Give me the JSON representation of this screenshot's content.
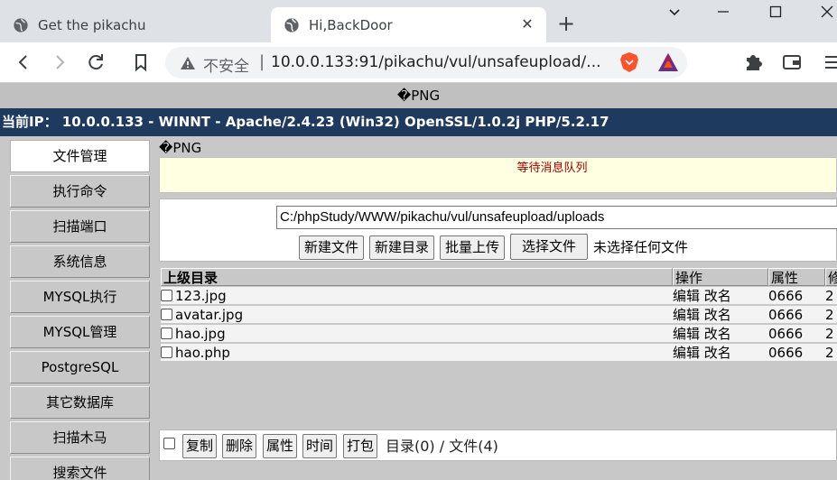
{
  "browser": {
    "tabs": [
      {
        "title": "Get the pikachu",
        "active": false
      },
      {
        "title": "Hi,BackDoor",
        "active": true
      }
    ],
    "new_tab": "+",
    "window_controls": {
      "minimize": "—",
      "maximize": "☐",
      "close": "✕",
      "dropdown": "⌄"
    },
    "omnibox": {
      "security_label": "不安全",
      "separator": "|",
      "url": "10.0.0.133:91/pikachu/vul/unsafeupload/..."
    },
    "icons": [
      "back-icon",
      "forward-icon",
      "reload-icon",
      "bookmark-icon",
      "warning-icon",
      "brave-shield-icon",
      "bat-rewards-icon",
      "extensions-icon",
      "wallet-icon",
      "menu-icon"
    ]
  },
  "page": {
    "top_text": "�PNG",
    "ip_bar": "当前IP： 10.0.0.133 - WINNT - Apache/2.4.23 (Win32) OpenSSL/1.0.2j PHP/5.2.17",
    "sidebar": [
      {
        "label": "文件管理",
        "active": true
      },
      {
        "label": "执行命令",
        "active": false
      },
      {
        "label": "扫描端口",
        "active": false
      },
      {
        "label": "系统信息",
        "active": false
      },
      {
        "label": "MYSQL执行",
        "active": false
      },
      {
        "label": "MYSQL管理",
        "active": false
      },
      {
        "label": "PostgreSQL",
        "active": false
      },
      {
        "label": "其它数据库",
        "active": false
      },
      {
        "label": "扫描木马",
        "active": false
      },
      {
        "label": "搜索文件",
        "active": false
      }
    ],
    "main": {
      "png_text": "�PNG",
      "message": "等待消息队列",
      "path_value": "C:/phpStudy/WWW/pikachu/vul/unsafeupload/uploads",
      "buttons": {
        "new_file": "新建文件",
        "new_dir": "新建目录",
        "batch_upload": "批量上传",
        "choose_file": "选择文件",
        "no_file": "未选择任何文件"
      },
      "table": {
        "headers": {
          "name": "上级目录",
          "ops": "操作",
          "attr": "属性",
          "mod": "修"
        },
        "rows": [
          {
            "name": "123.jpg",
            "edit": "编辑",
            "rename": "改名",
            "attr": "0666",
            "mod": "2"
          },
          {
            "name": "avatar.jpg",
            "edit": "编辑",
            "rename": "改名",
            "attr": "0666",
            "mod": "2"
          },
          {
            "name": "hao.jpg",
            "edit": "编辑",
            "rename": "改名",
            "attr": "0666",
            "mod": "2"
          },
          {
            "name": "hao.php",
            "edit": "编辑",
            "rename": "改名",
            "attr": "0666",
            "mod": "2"
          }
        ]
      },
      "bottom": {
        "copy": "复制",
        "delete": "删除",
        "attr": "属性",
        "time": "时间",
        "pack": "打包",
        "count": "目录(0) / 文件(4)"
      }
    }
  }
}
